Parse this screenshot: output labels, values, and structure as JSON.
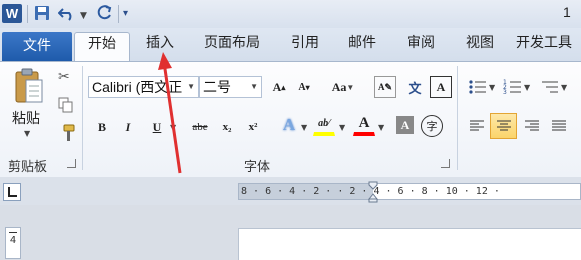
{
  "app": {
    "logo_letter": "W",
    "title_fragment": "1"
  },
  "qat": {
    "save_icon": "save-icon",
    "undo_icon": "undo-icon",
    "redo_icon": "redo-icon",
    "customize_icon": "customize-icon"
  },
  "tabs": {
    "file": "文件",
    "items": [
      "开始",
      "插入",
      "页面布局",
      "引用",
      "邮件",
      "审阅",
      "视图",
      "开发工具"
    ],
    "active": "开始"
  },
  "clipboard": {
    "paste_label": "粘贴",
    "group_label": "剪贴板",
    "icons": [
      "paste-icon",
      "cut-icon",
      "copy-icon",
      "format-painter-icon"
    ]
  },
  "font": {
    "font_name": "Calibri (西文正",
    "font_size": "二号",
    "group_label": "字体",
    "grow_label": "A",
    "shrink_label": "A",
    "case_label": "Aa",
    "pinyin_label": "文",
    "border_label": "A",
    "bold": "B",
    "italic": "I",
    "underline": "U",
    "strike": "abe",
    "subscript": "x₂",
    "superscript": "x²",
    "effects_label": "A",
    "highlight_label": "ab⁄",
    "color_label": "A",
    "shade_label": "A",
    "enclose_label": "字"
  },
  "ruler": {
    "text": "8 · 6 · 4 · 2 ·    · 2 · 4 · 6 · 8 · 10 · 12 ·",
    "vertical": "4"
  },
  "colors": {
    "accent": "#2b5797",
    "highlight": "#ffff00",
    "font_color": "#ff0000",
    "arrow": "#e03030"
  }
}
